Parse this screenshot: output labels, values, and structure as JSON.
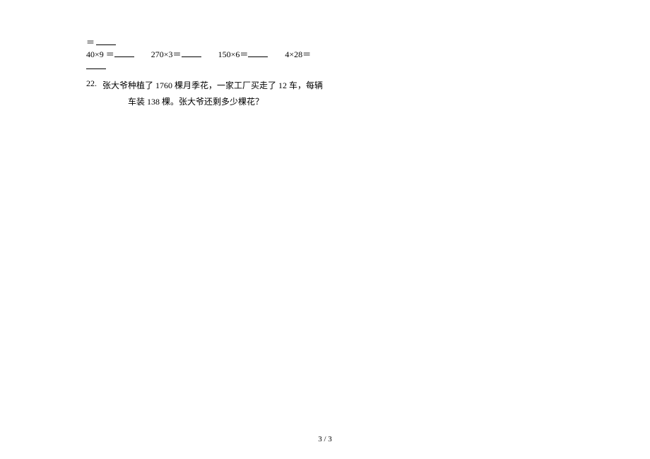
{
  "line1": {
    "equals": "＝"
  },
  "line2": {
    "eq1": "40×9  ＝",
    "eq2": "270×3＝",
    "eq3": "150×6＝",
    "eq4": "4×28＝"
  },
  "q22": {
    "num": "22.",
    "text1": "张大爷种植了 1760 棵月季花，一家工厂买走了 12 车，每辆",
    "text2": "车装 138 棵。张大爷还剩多少棵花？"
  },
  "pager": "3 / 3"
}
